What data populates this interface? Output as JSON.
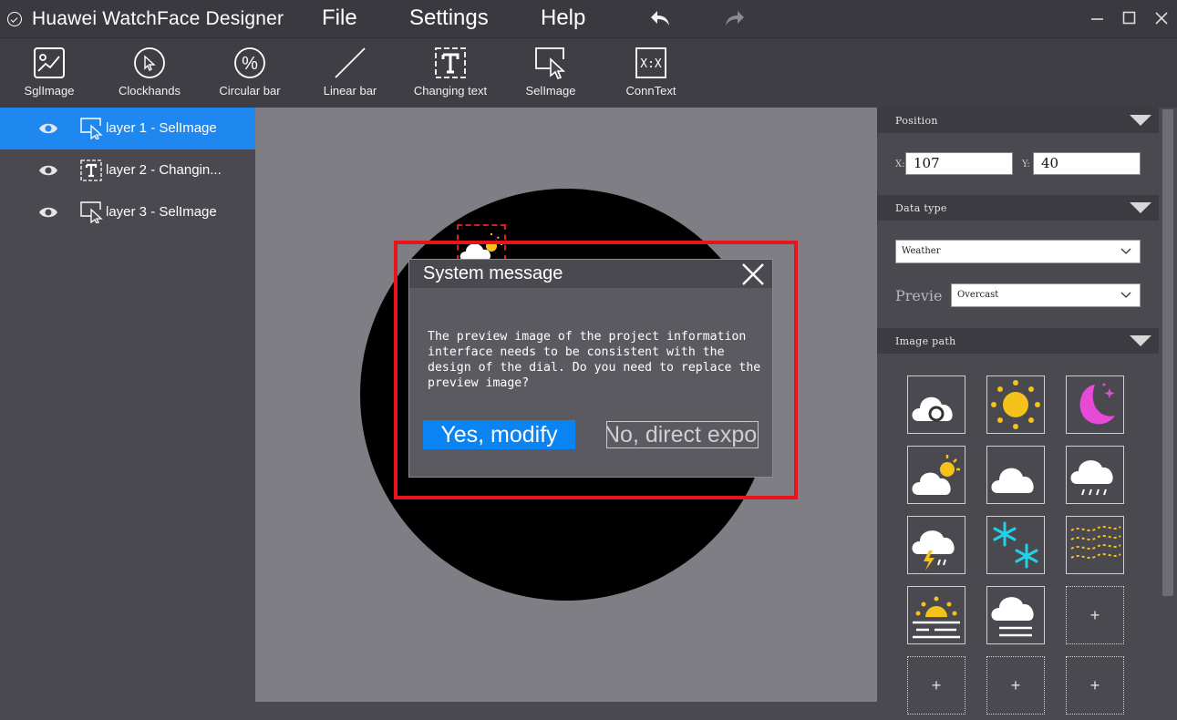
{
  "app": {
    "title": "Huawei WatchFace Designer"
  },
  "menu": {
    "file": "File",
    "settings": "Settings",
    "help": "Help"
  },
  "toolbar": {
    "items": [
      {
        "label": "SglImage",
        "icon": "image-icon"
      },
      {
        "label": "Clockhands",
        "icon": "cursor-circle-icon"
      },
      {
        "label": "Circular bar",
        "icon": "percent-circle-icon"
      },
      {
        "label": "Linear bar",
        "icon": "diagonal-line-icon"
      },
      {
        "label": "Changing text",
        "icon": "text-box-icon"
      },
      {
        "label": "SelImage",
        "icon": "select-cursor-icon"
      },
      {
        "label": "ConnText",
        "icon": "conn-text-icon",
        "icon_text": "X:X"
      }
    ]
  },
  "layers": [
    {
      "name": "layer 1 - SelImage",
      "icon": "select-cursor-icon",
      "active": true
    },
    {
      "name": "layer 2 - Changin...",
      "icon": "text-box-icon",
      "active": false
    },
    {
      "name": "layer 3 - SelImage",
      "icon": "select-cursor-icon",
      "active": false
    }
  ],
  "dialog": {
    "title": "System message",
    "message": "The preview image of the project information\ninterface needs to be consistent with the\ndesign of the dial. Do you need to replace the\npreview image?",
    "yes_label": "Yes, modify",
    "no_label": "No, direct export"
  },
  "properties": {
    "position": {
      "title": "Position",
      "x_label": "X:",
      "x_value": "107",
      "y_label": "Y:",
      "y_value": "40"
    },
    "data_type": {
      "title": "Data type",
      "value": "Weather",
      "preview_label": "Previe",
      "preview_value": "Overcast"
    },
    "image_path": {
      "title": "Image path",
      "tiles": [
        "overcast-cloud-icon",
        "sun-icon",
        "moon-star-icon",
        "partly-cloudy-icon",
        "cloud-icon",
        "rain-cloud-icon",
        "thunderstorm-icon",
        "snowflake-icon",
        "haze-icon",
        "sunrise-fog-icon",
        "cloud-fog-icon",
        "add-tile",
        "add-tile",
        "add-tile",
        "add-tile"
      ],
      "add_symbol": "+"
    }
  },
  "colors": {
    "accent": "#1e87f0",
    "button_primary": "#0a84f2",
    "highlight": "#e8141b",
    "sun": "#f5c21b",
    "moon": "#e64ad6",
    "snow": "#22d3e8"
  }
}
